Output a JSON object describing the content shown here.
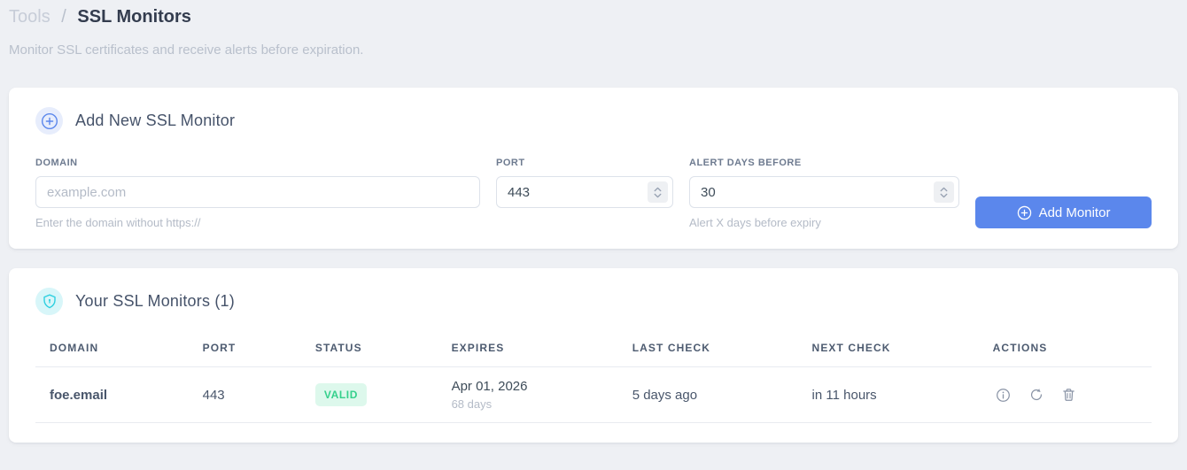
{
  "page": {
    "breadcrumb": {
      "section": "Tools",
      "separator": "/",
      "current": "SSL Monitors"
    },
    "subtitle": "Monitor SSL certificates and receive alerts before expiration."
  },
  "add_monitor": {
    "title": "Add New SSL Monitor",
    "fields": {
      "domain": {
        "label": "DOMAIN",
        "placeholder": "example.com",
        "value": "",
        "hint": "Enter the domain without https://"
      },
      "port": {
        "label": "PORT",
        "value": "443"
      },
      "alert_days": {
        "label": "ALERT DAYS BEFORE",
        "value": "30",
        "hint": "Alert X days before expiry"
      }
    },
    "submit_label": "Add Monitor"
  },
  "monitors": {
    "title": "Your SSL Monitors (1)",
    "columns": [
      "DOMAIN",
      "PORT",
      "STATUS",
      "EXPIRES",
      "LAST CHECK",
      "NEXT CHECK",
      "ACTIONS"
    ],
    "rows": [
      {
        "domain": "foe.email",
        "port": "443",
        "status": "VALID",
        "expires_date": "Apr 01, 2026",
        "expires_in": "68 days",
        "last_check": "5 days ago",
        "next_check": "in 11 hours"
      }
    ]
  },
  "icons": {
    "add_header": "plus-circle-icon",
    "list_header": "shield-icon",
    "button": "plus-circle-icon",
    "row_actions": [
      "info-icon",
      "refresh-icon",
      "trash-icon"
    ],
    "number_stepper": "chevron-up-down-icon"
  },
  "colors": {
    "page_background": "#eef0f4",
    "card_background": "#ffffff",
    "accent_blue": "#5b87ec",
    "link_blue": "#5a87ec",
    "valid_badge_bg": "#ddf8ec",
    "valid_badge_text": "#35d08c",
    "shield_cyan": "#2fd0e0",
    "muted_text": "#b4bbc7",
    "heading_text": "#333c4e"
  }
}
